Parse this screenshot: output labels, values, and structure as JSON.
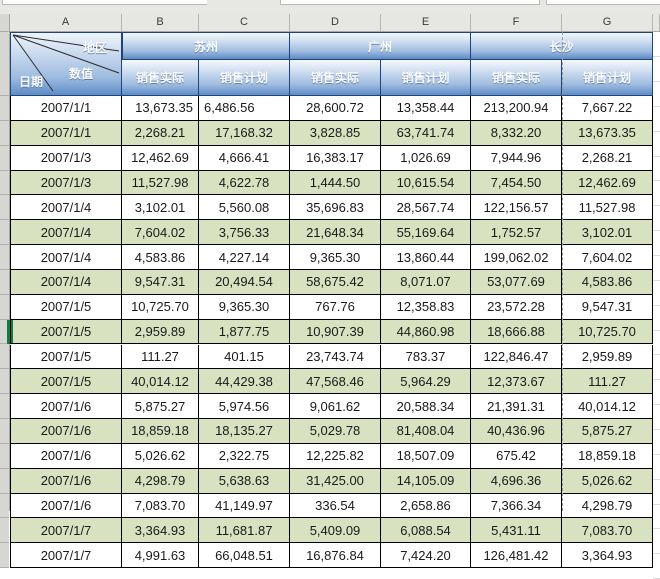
{
  "spreadsheet": {
    "column_headers": [
      "A",
      "B",
      "C",
      "D",
      "E",
      "F",
      "G"
    ],
    "corner": {
      "region_label": "地区",
      "value_label": "数值",
      "date_label": "日期"
    },
    "region_groups": [
      {
        "name": "苏州",
        "columns": [
          "B",
          "C"
        ]
      },
      {
        "name": "广州",
        "columns": [
          "D",
          "E"
        ]
      },
      {
        "name": "长沙",
        "columns": [
          "F",
          "G"
        ]
      }
    ],
    "sub_headers": [
      "销售实际",
      "销售计划",
      "销售实际",
      "销售计划",
      "销售实际",
      "销售计划"
    ],
    "selected_row_index": 9,
    "page_break_after_column": "F",
    "colors": {
      "header_gradient_top": "#f4f8fd",
      "header_gradient_bottom": "#5c8bc6",
      "header_border": "#20447a",
      "banded_row": "#d9e2c0",
      "plain_row": "#ffffff",
      "selection_marker": "#107c41",
      "grid_line": "#000000",
      "column_header_bar": "#e6e6e3"
    },
    "rows": [
      {
        "date": "2007/1/1",
        "values": [
          "13,673.35",
          "6,486.56",
          "28,600.72",
          "13,358.44",
          "213,200.94",
          "7,667.22"
        ]
      },
      {
        "date": "2007/1/1",
        "values": [
          "2,268.21",
          "17,168.32",
          "3,828.85",
          "63,741.74",
          "8,332.20",
          "13,673.35"
        ]
      },
      {
        "date": "2007/1/3",
        "values": [
          "12,462.69",
          "4,666.41",
          "16,383.17",
          "1,026.69",
          "7,944.96",
          "2,268.21"
        ]
      },
      {
        "date": "2007/1/3",
        "values": [
          "11,527.98",
          "4,622.78",
          "1,444.50",
          "10,615.54",
          "7,454.50",
          "12,462.69"
        ]
      },
      {
        "date": "2007/1/4",
        "values": [
          "3,102.01",
          "5,560.08",
          "35,696.83",
          "28,567.74",
          "122,156.57",
          "11,527.98"
        ]
      },
      {
        "date": "2007/1/4",
        "values": [
          "7,604.02",
          "3,756.33",
          "21,648.34",
          "55,169.64",
          "1,752.57",
          "3,102.01"
        ]
      },
      {
        "date": "2007/1/4",
        "values": [
          "4,583.86",
          "4,227.14",
          "9,365.30",
          "13,860.44",
          "199,062.02",
          "7,604.02"
        ]
      },
      {
        "date": "2007/1/4",
        "values": [
          "9,547.31",
          "20,494.54",
          "58,675.42",
          "8,071.07",
          "53,077.69",
          "4,583.86"
        ]
      },
      {
        "date": "2007/1/5",
        "values": [
          "10,725.70",
          "9,365.30",
          "767.76",
          "12,358.83",
          "23,572.28",
          "9,547.31"
        ]
      },
      {
        "date": "2007/1/5",
        "values": [
          "2,959.89",
          "1,877.75",
          "10,907.39",
          "44,860.98",
          "18,666.88",
          "10,725.70"
        ]
      },
      {
        "date": "2007/1/5",
        "values": [
          "111.27",
          "401.15",
          "23,743.74",
          "783.37",
          "122,846.47",
          "2,959.89"
        ]
      },
      {
        "date": "2007/1/5",
        "values": [
          "40,014.12",
          "44,429.38",
          "47,568.46",
          "5,964.29",
          "12,373.67",
          "111.27"
        ]
      },
      {
        "date": "2007/1/6",
        "values": [
          "5,875.27",
          "5,974.56",
          "9,061.62",
          "20,588.34",
          "21,391.31",
          "40,014.12"
        ]
      },
      {
        "date": "2007/1/6",
        "values": [
          "18,859.18",
          "18,135.27",
          "5,029.78",
          "81,408.04",
          "40,436.96",
          "5,875.27"
        ]
      },
      {
        "date": "2007/1/6",
        "values": [
          "5,026.62",
          "2,322.75",
          "12,225.82",
          "18,507.09",
          "675.42",
          "18,859.18"
        ]
      },
      {
        "date": "2007/1/6",
        "values": [
          "4,298.79",
          "5,638.63",
          "31,425.00",
          "14,105.09",
          "4,696.36",
          "5,026.62"
        ]
      },
      {
        "date": "2007/1/6",
        "values": [
          "7,083.70",
          "41,149.97",
          "336.54",
          "2,658.86",
          "7,366.34",
          "4,298.79"
        ]
      },
      {
        "date": "2007/1/7",
        "values": [
          "3,364.93",
          "11,681.87",
          "5,409.09",
          "6,088.54",
          "5,431.11",
          "7,083.70"
        ]
      },
      {
        "date": "2007/1/7",
        "values": [
          "4,991.63",
          "66,048.51",
          "16,876.84",
          "7,424.20",
          "126,481.42",
          "3,364.93"
        ]
      }
    ]
  }
}
